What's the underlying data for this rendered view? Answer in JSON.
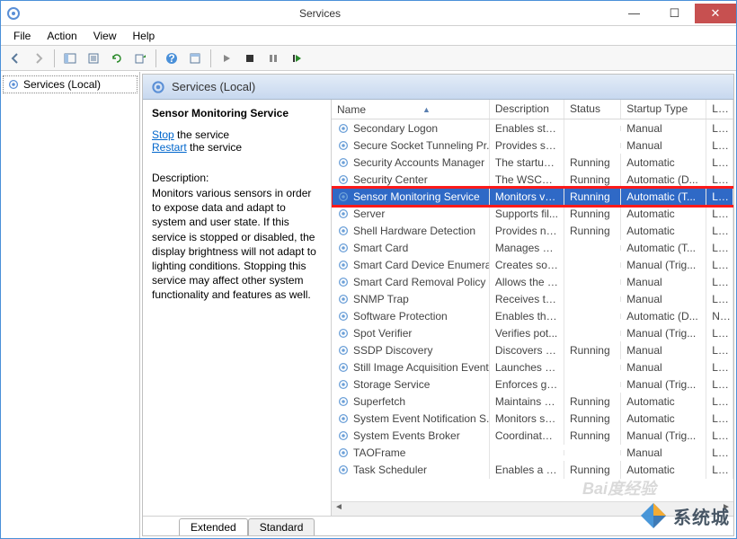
{
  "window": {
    "title": "Services"
  },
  "menubar": [
    "File",
    "Action",
    "View",
    "Help"
  ],
  "tree": {
    "root": "Services (Local)"
  },
  "header": {
    "label": "Services (Local)"
  },
  "detail": {
    "name": "Sensor Monitoring Service",
    "stop_label": "Stop",
    "stop_suffix": " the service",
    "restart_label": "Restart",
    "restart_suffix": " the service",
    "desc_label": "Description:",
    "desc_text": "Monitors various sensors in order to expose data and adapt to system and user state.  If this service is stopped or disabled, the display brightness will not adapt to lighting conditions. Stopping this service may affect other system functionality and features as well."
  },
  "columns": {
    "name": "Name",
    "desc": "Description",
    "status": "Status",
    "startup": "Startup Type",
    "logon": "Log"
  },
  "rows": [
    {
      "name": "Secondary Logon",
      "desc": "Enables star...",
      "status": "",
      "startup": "Manual",
      "log": "Loc",
      "sel": false
    },
    {
      "name": "Secure Socket Tunneling Pr...",
      "desc": "Provides su...",
      "status": "",
      "startup": "Manual",
      "log": "Loc",
      "sel": false
    },
    {
      "name": "Security Accounts Manager",
      "desc": "The startup ...",
      "status": "Running",
      "startup": "Automatic",
      "log": "Loc",
      "sel": false
    },
    {
      "name": "Security Center",
      "desc": "The WSCSV...",
      "status": "Running",
      "startup": "Automatic (D...",
      "log": "Loc",
      "sel": false
    },
    {
      "name": "Sensor Monitoring Service",
      "desc": "Monitors va...",
      "status": "Running",
      "startup": "Automatic (T...",
      "log": "Loc",
      "sel": true
    },
    {
      "name": "Server",
      "desc": "Supports fil...",
      "status": "Running",
      "startup": "Automatic",
      "log": "Loc",
      "sel": false
    },
    {
      "name": "Shell Hardware Detection",
      "desc": "Provides no...",
      "status": "Running",
      "startup": "Automatic",
      "log": "Loc",
      "sel": false
    },
    {
      "name": "Smart Card",
      "desc": "Manages ac...",
      "status": "",
      "startup": "Automatic (T...",
      "log": "Loc",
      "sel": false
    },
    {
      "name": "Smart Card Device Enumera...",
      "desc": "Creates soft...",
      "status": "",
      "startup": "Manual (Trig...",
      "log": "Loc",
      "sel": false
    },
    {
      "name": "Smart Card Removal Policy",
      "desc": "Allows the s...",
      "status": "",
      "startup": "Manual",
      "log": "Loc",
      "sel": false
    },
    {
      "name": "SNMP Trap",
      "desc": "Receives tra...",
      "status": "",
      "startup": "Manual",
      "log": "Loc",
      "sel": false
    },
    {
      "name": "Software Protection",
      "desc": "Enables the ...",
      "status": "",
      "startup": "Automatic (D...",
      "log": "Net",
      "sel": false
    },
    {
      "name": "Spot Verifier",
      "desc": "Verifies pot...",
      "status": "",
      "startup": "Manual (Trig...",
      "log": "Loc",
      "sel": false
    },
    {
      "name": "SSDP Discovery",
      "desc": "Discovers n...",
      "status": "Running",
      "startup": "Manual",
      "log": "Loc",
      "sel": false
    },
    {
      "name": "Still Image Acquisition Events",
      "desc": "Launches a...",
      "status": "",
      "startup": "Manual",
      "log": "Loc",
      "sel": false
    },
    {
      "name": "Storage Service",
      "desc": "Enforces gr...",
      "status": "",
      "startup": "Manual (Trig...",
      "log": "Loc",
      "sel": false
    },
    {
      "name": "Superfetch",
      "desc": "Maintains a...",
      "status": "Running",
      "startup": "Automatic",
      "log": "Loc",
      "sel": false
    },
    {
      "name": "System Event Notification S...",
      "desc": "Monitors sy...",
      "status": "Running",
      "startup": "Automatic",
      "log": "Loc",
      "sel": false
    },
    {
      "name": "System Events Broker",
      "desc": "Coordinates...",
      "status": "Running",
      "startup": "Manual (Trig...",
      "log": "Loc",
      "sel": false
    },
    {
      "name": "TAOFrame",
      "desc": "",
      "status": "",
      "startup": "Manual",
      "log": "Loc",
      "sel": false
    },
    {
      "name": "Task Scheduler",
      "desc": "Enables a us...",
      "status": "Running",
      "startup": "Automatic",
      "log": "Loc",
      "sel": false
    }
  ],
  "tabs": {
    "extended": "Extended",
    "standard": "Standard"
  },
  "watermark": {
    "text": "系统城",
    "baidu": "Bai度经验"
  }
}
